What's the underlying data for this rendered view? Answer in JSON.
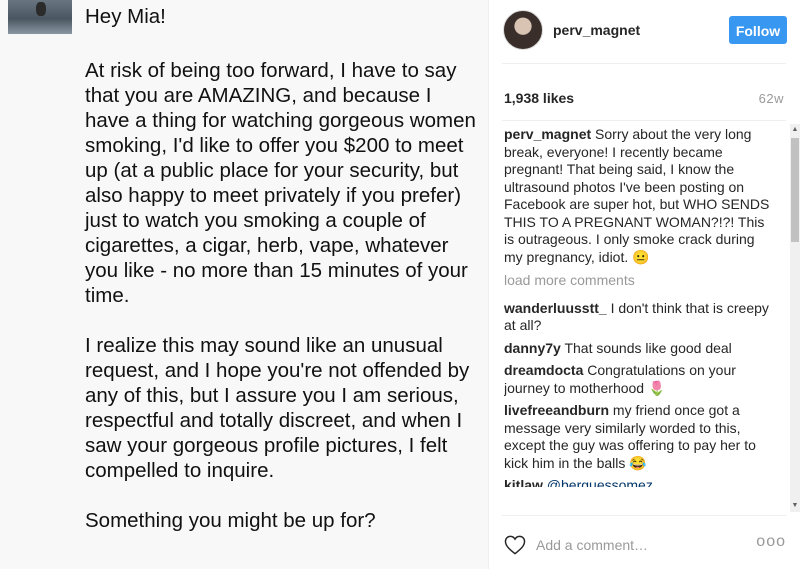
{
  "post": {
    "message": {
      "greeting": "Hey Mia!",
      "paragraph1": "At risk of being too forward, I have to say that you are AMAZING, and because I have a thing for watching gorgeous women smoking, I'd like to offer you $200 to meet up (at a public place for your security, but also happy to meet privately if you prefer) just to watch you smoking a couple of cigarettes, a cigar, herb, vape, whatever you like - no more than 15 minutes of your time.",
      "paragraph2": "I realize this may sound like an unusual request, and I hope you're not offended by any of this, but I assure you I am serious, respectful and totally discreet, and when I saw your gorgeous profile pictures, I felt compelled to inquire.",
      "closing": "Something you might be up for?"
    }
  },
  "header": {
    "username": "perv_magnet",
    "follow_label": "Follow"
  },
  "stats": {
    "likes": "1,938 likes",
    "age": "62w"
  },
  "caption": {
    "username": "perv_magnet",
    "text": "Sorry about the very long break, everyone! I recently became pregnant! That being said, I know the ultrasound photos I've been posting on Facebook are super hot, but WHO SENDS THIS TO A PREGNANT WOMAN?!?! This is outrageous. I only smoke crack during my pregnancy, idiot. 😐"
  },
  "load_more": "load more comments",
  "comments": [
    {
      "username": "wanderluusstt_",
      "text": "I don't think that is creepy at all?"
    },
    {
      "username": "danny7y",
      "text": "That sounds like good deal"
    },
    {
      "username": "dreamdocta",
      "text": "Congratulations on your journey to motherhood 🌷"
    },
    {
      "username": "livefreeandburn",
      "text": "my friend once got a message very similarly worded to this, except the guy was offering to pay her to kick him in the balls 😂"
    },
    {
      "username": "kitlaw",
      "text": "@berguessomez"
    }
  ],
  "add_comment": {
    "placeholder": "Add a comment…",
    "more_label": "ooo"
  },
  "colors": {
    "follow_button": "#3897f0",
    "muted_text": "#999999",
    "text": "#262626"
  }
}
